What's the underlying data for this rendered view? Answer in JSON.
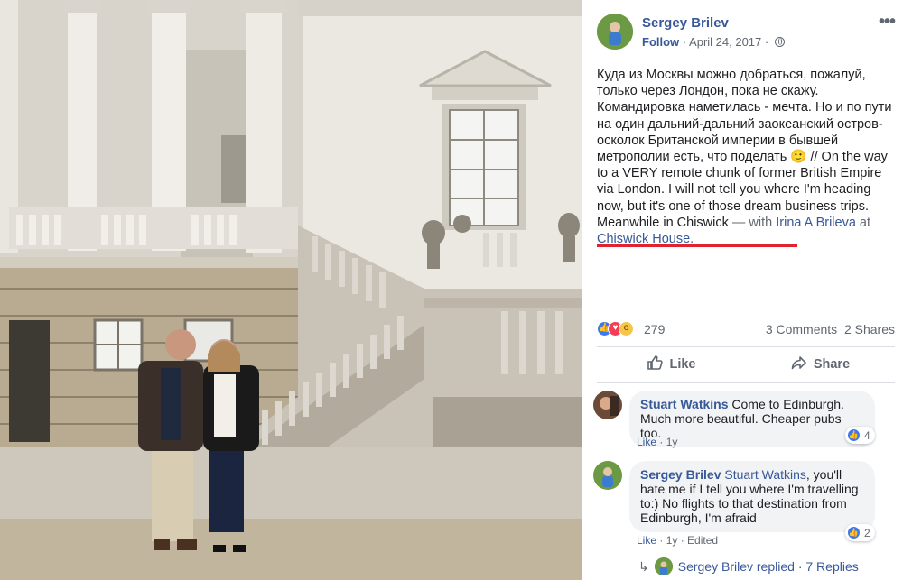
{
  "post": {
    "author": "Sergey Brilev",
    "follow": "Follow",
    "separator": "·",
    "date": "April 24, 2017",
    "date_sep": "·",
    "more": "•••",
    "text_ru": "Куда из Москвы можно добраться, пожалуй, только через Лондон, пока не скажу. Командировка наметилась - мечта. Но и по пути на один дальний-дальний заокеанский остров-осколок Британской империи в бывшей метрополии есть, что поделать",
    "emoji": "🙂",
    "text_en": " // On the way to a VERY remote chunk of former British Empire via London. I will not tell you where I'm heading now, but it's one of those dream business trips. Meanwhile in Chiswick",
    "with_prefix": " — with ",
    "tagged_person": "Irina A Brileva",
    "at_word": " at ",
    "place": "Chiswick House",
    "end": "."
  },
  "reactions": {
    "count": "279",
    "comments": "3 Comments",
    "shares": "2 Shares",
    "icons": [
      "like-icon",
      "love-icon",
      "wow-icon"
    ]
  },
  "actions": {
    "like_label": "Like",
    "share_label": "Share"
  },
  "comments": [
    {
      "author": "Stuart Watkins",
      "text": "Come to Edinburgh. Much more beautiful. Cheaper pubs too.",
      "like": "Like",
      "time": "1y",
      "reactions": "4"
    },
    {
      "author": "Sergey Brilev",
      "tag": "Stuart Watkins",
      "text": ", you'll hate me if I tell you where I'm travelling to:) No flights to that destination from Edinburgh, I'm afraid",
      "like": "Like",
      "time": "1y",
      "edited": "Edited",
      "reactions": "2"
    }
  ],
  "replies": {
    "author": "Sergey Brilev",
    "replied": "replied",
    "sep": "·",
    "count": "7 Replies"
  },
  "colors": {
    "link": "#385898",
    "muted": "#606770",
    "underline": "#e0232f",
    "bubble": "#f2f3f5"
  }
}
